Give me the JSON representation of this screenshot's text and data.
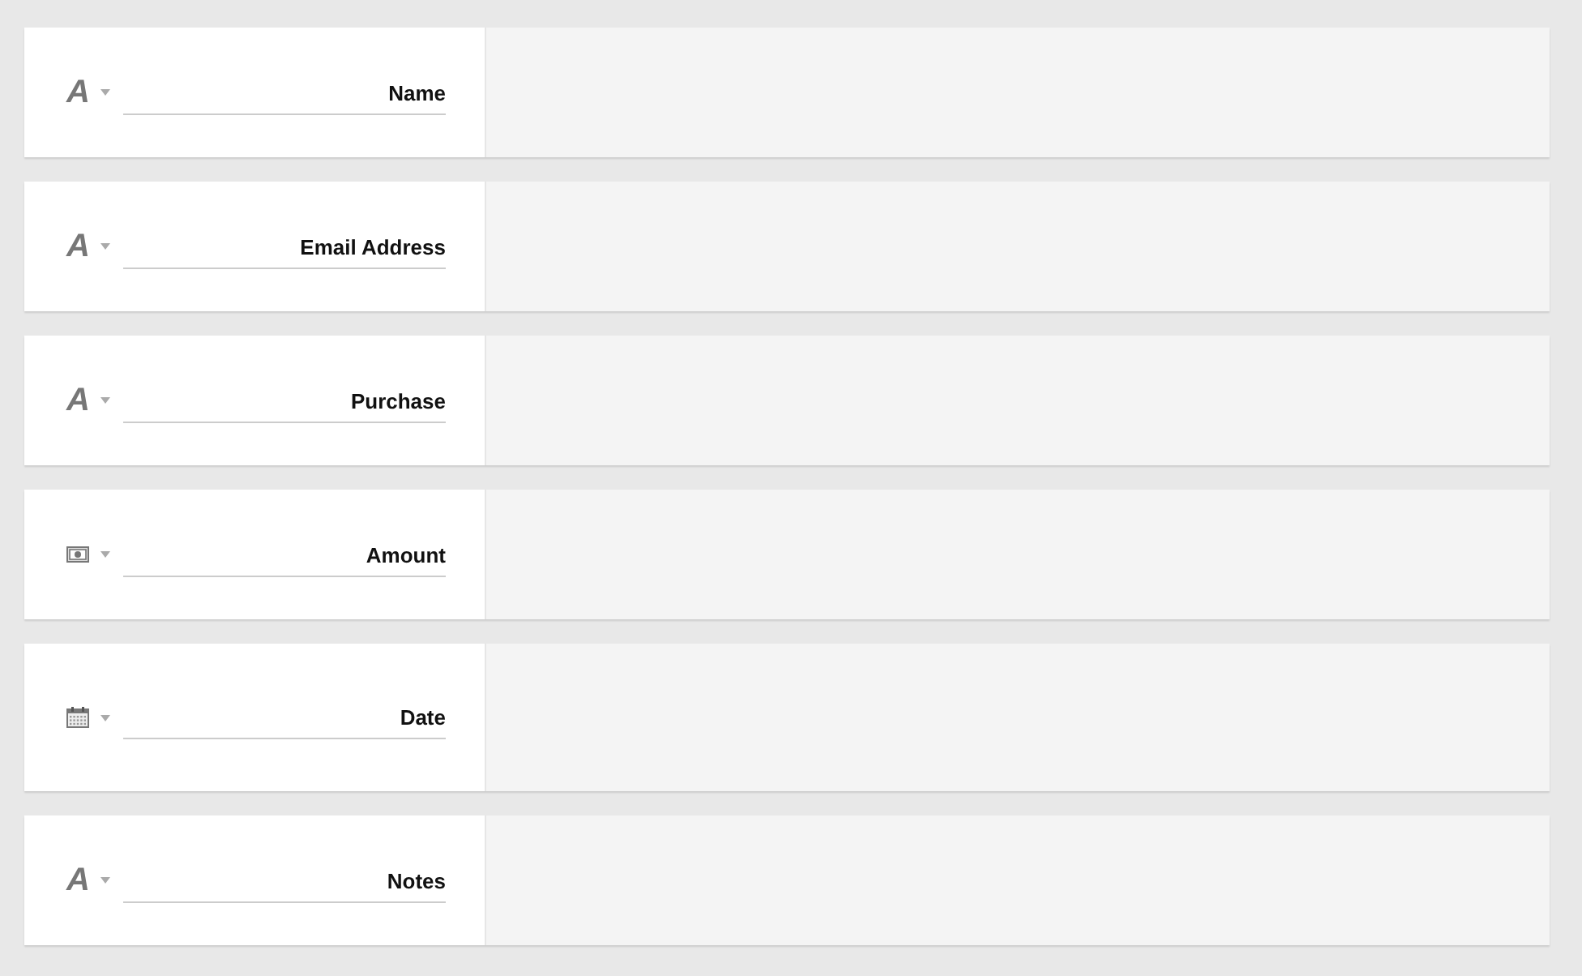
{
  "fields": [
    {
      "kind": "text",
      "icon": "A",
      "label": "Name"
    },
    {
      "kind": "text",
      "icon": "A",
      "label": "Email Address"
    },
    {
      "kind": "text",
      "icon": "A",
      "label": "Purchase"
    },
    {
      "kind": "currency",
      "label": "Amount"
    },
    {
      "kind": "date",
      "label": "Date"
    },
    {
      "kind": "text",
      "icon": "A",
      "label": "Notes"
    }
  ]
}
